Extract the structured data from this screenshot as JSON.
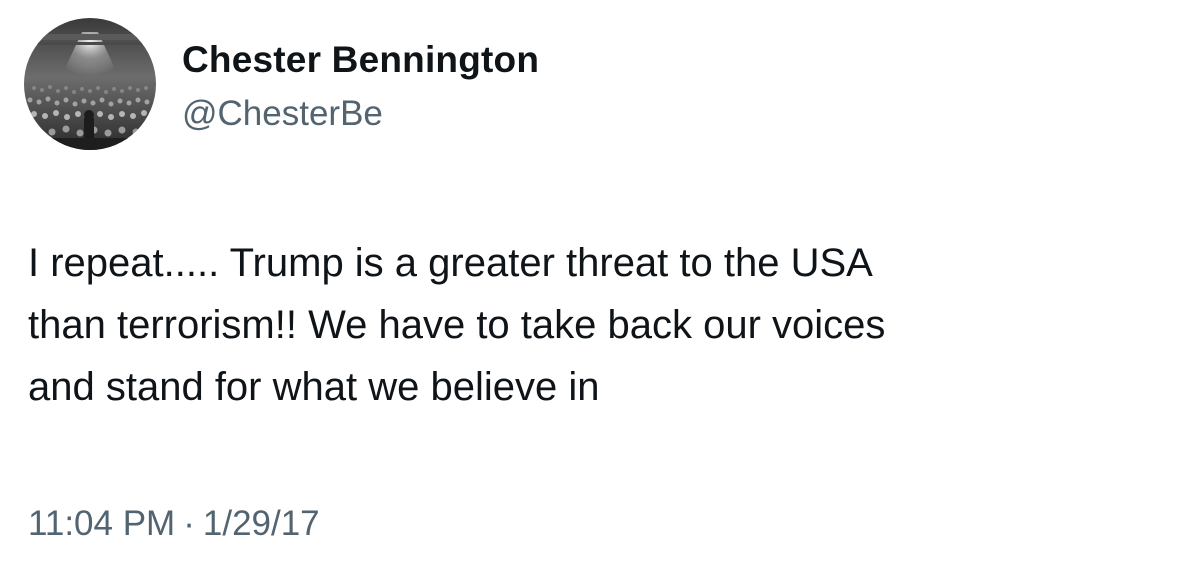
{
  "author": {
    "display_name": "Chester Bennington",
    "handle": "@ChesterBe",
    "avatar_icon": "concert-crowd-avatar"
  },
  "tweet": {
    "text": "I repeat..... Trump is a greater threat to the USA\nthan terrorism!! We have to take back our voices\nand stand for what we believe in",
    "time": "11:04 PM",
    "separator": "·",
    "date": "1/29/17"
  },
  "colors": {
    "text_primary": "#0f1419",
    "text_secondary": "#536471",
    "background": "#ffffff"
  }
}
